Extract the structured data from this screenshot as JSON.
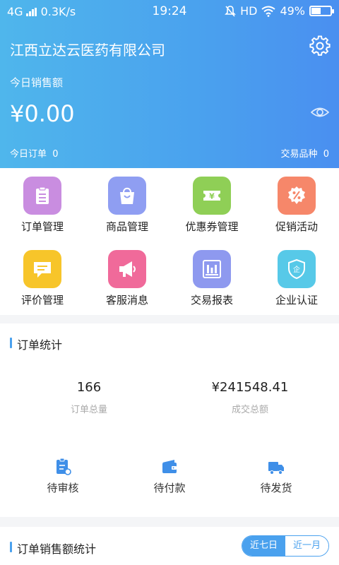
{
  "status_bar": {
    "network": "4G",
    "speed": "0.3K/s",
    "time": "19:24",
    "hd": "HD",
    "battery": "49%",
    "battery_level": 0.49
  },
  "header": {
    "company": "江西立达云医药有限公司",
    "sales_label": "今日销售额",
    "sales_value": "¥0.00",
    "today_orders_label": "今日订单",
    "today_orders_value": "0",
    "trade_kinds_label": "交易品种",
    "trade_kinds_value": "0"
  },
  "menu": [
    {
      "label": "订单管理",
      "icon": "clipboard-icon",
      "color": "#c98de0"
    },
    {
      "label": "商品管理",
      "icon": "shopping-bag-icon",
      "color": "#8f9ef2"
    },
    {
      "label": "优惠券管理",
      "icon": "coupon-icon",
      "color": "#8fcf56"
    },
    {
      "label": "促销活动",
      "icon": "discount-tag-icon",
      "color": "#f6876a"
    },
    {
      "label": "评价管理",
      "icon": "comment-icon",
      "color": "#f7c52a"
    },
    {
      "label": "客服消息",
      "icon": "megaphone-icon",
      "color": "#f06a9a"
    },
    {
      "label": "交易报表",
      "icon": "report-icon",
      "color": "#8e99ef"
    },
    {
      "label": "企业认证",
      "icon": "shield-icon",
      "color": "#57c9e8"
    }
  ],
  "order_stats": {
    "title": "订单统计",
    "total_value": "166",
    "total_label": "订单总量",
    "amount_value": "¥241548.41",
    "amount_label": "成交总额",
    "pending": [
      {
        "label": "待审核",
        "icon": "review-icon"
      },
      {
        "label": "待付款",
        "icon": "wallet-icon"
      },
      {
        "label": "待发货",
        "icon": "truck-icon"
      }
    ]
  },
  "sales_stats": {
    "title": "订单销售额统计",
    "range_options": [
      "近七日",
      "近一月"
    ],
    "selected_range": "近七日"
  },
  "colors": {
    "accent": "#4aa1ee",
    "pending_icon": "#3f8fe8"
  }
}
